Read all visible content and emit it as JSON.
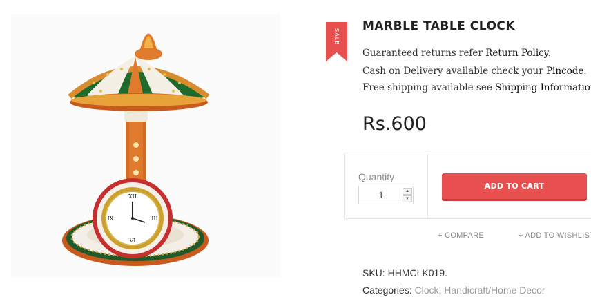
{
  "product": {
    "title": "MARBLE TABLE CLOCK",
    "sale_badge": "SALE",
    "price": "Rs.600",
    "image_alt": "Marble table clock with umbrella top"
  },
  "info": {
    "line1_text": "Guaranteed returns refer ",
    "line1_link": "Return Policy",
    "line2_text": "Cash on Delivery available check your ",
    "line2_link": "Pincode",
    "line3_text": "Free shipping available see ",
    "line3_link": "Shipping Information"
  },
  "cart": {
    "quantity_label": "Quantity",
    "quantity_value": "1",
    "add_to_cart_label": "ADD TO CART"
  },
  "actions": {
    "compare_label": "+ COMPARE",
    "wishlist_label": "+ ADD TO WISHLIST"
  },
  "meta": {
    "sku_label": "SKU:",
    "sku_value": "HHMCLK019.",
    "categories_label": "Categories:",
    "category_1": "Clock",
    "category_2": "Handicraft/Home Decor"
  },
  "colors": {
    "accent": "#e84f4f",
    "text": "#333333",
    "muted": "#888888"
  }
}
